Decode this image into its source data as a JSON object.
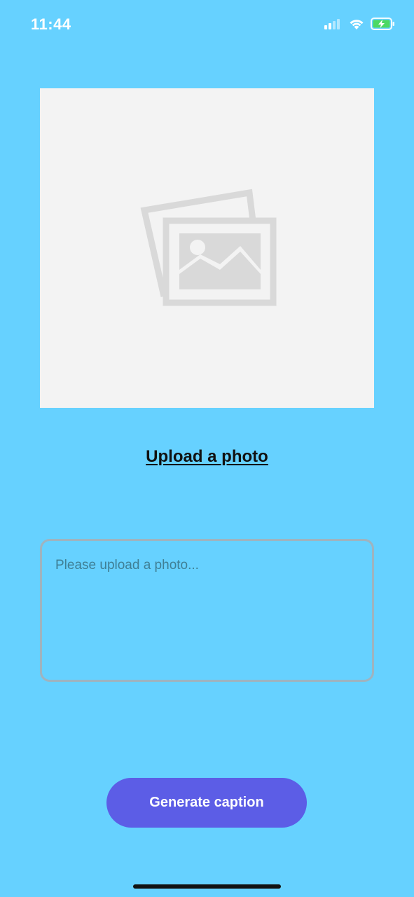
{
  "status_bar": {
    "time": "11:44",
    "icons": [
      "signal-icon",
      "wifi-icon",
      "battery-charging-icon"
    ]
  },
  "photo": {
    "placeholder_icon": "image-placeholder-icon"
  },
  "upload": {
    "label": "Upload a photo"
  },
  "caption": {
    "placeholder": "Please upload a photo...",
    "value": ""
  },
  "generate": {
    "label": "Generate caption"
  },
  "colors": {
    "background": "#66d1ff",
    "button": "#5c5de6",
    "frame": "#f3f3f3"
  }
}
